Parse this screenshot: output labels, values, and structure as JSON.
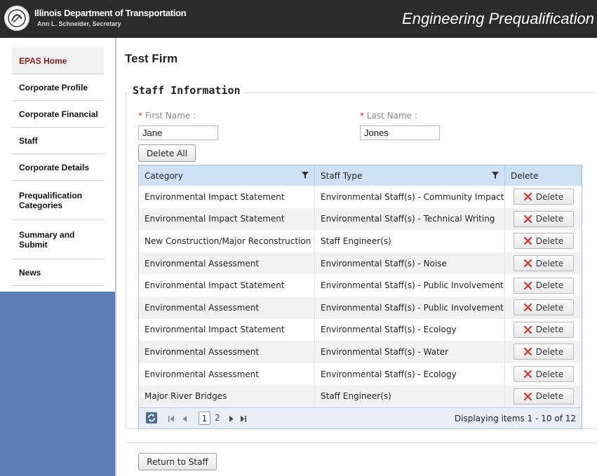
{
  "header": {
    "agency": "Illinois Department of Transportation",
    "secretary": "Ann L. Schneider, Secretary",
    "app_title": "Engineering Prequalification"
  },
  "sidebar": {
    "items": [
      {
        "label": "EPAS Home",
        "active": true
      },
      {
        "label": "Corporate Profile"
      },
      {
        "label": "Corporate Financial"
      },
      {
        "label": "Staff"
      },
      {
        "label": "Corporate Details"
      },
      {
        "label": "Prequalification Categories"
      },
      {
        "label": "Summary and Submit"
      },
      {
        "label": "News"
      }
    ]
  },
  "main": {
    "firm_title": "Test Firm",
    "section_title": "Staff Information",
    "first_name": {
      "required_mark": "*",
      "label": "First Name :",
      "value": "Jane"
    },
    "last_name": {
      "required_mark": "*",
      "label": "Last Name :",
      "value": "Jones"
    },
    "delete_all_label": "Delete All",
    "return_label": "Return to Staff"
  },
  "grid": {
    "columns": [
      "Category",
      "Staff Type",
      "Delete"
    ],
    "rows": [
      {
        "category": "Environmental Impact Statement",
        "staff_type": "Environmental Staff(s) - Community Impacts",
        "action": "Delete"
      },
      {
        "category": "Environmental Impact Statement",
        "staff_type": "Environmental Staff(s) - Technical Writing",
        "action": "Delete"
      },
      {
        "category": "New Construction/Major Reconstruction",
        "staff_type": "Staff Engineer(s)",
        "action": "Delete"
      },
      {
        "category": "Environmental Assessment",
        "staff_type": "Environmental Staff(s) - Noise",
        "action": "Delete"
      },
      {
        "category": "Environmental Impact Statement",
        "staff_type": "Environmental Staff(s) - Public Involvement",
        "action": "Delete"
      },
      {
        "category": "Environmental Assessment",
        "staff_type": "Environmental Staff(s) - Public Involvement",
        "action": "Delete"
      },
      {
        "category": "Environmental Impact Statement",
        "staff_type": "Environmental Staff(s) - Ecology",
        "action": "Delete"
      },
      {
        "category": "Environmental Assessment",
        "staff_type": "Environmental Staff(s) - Water",
        "action": "Delete"
      },
      {
        "category": "Environmental Assessment",
        "staff_type": "Environmental Staff(s) - Ecology",
        "action": "Delete"
      },
      {
        "category": "Major River Bridges",
        "staff_type": "Staff Engineer(s)",
        "action": "Delete"
      }
    ],
    "pager": {
      "pages": [
        "1",
        "2"
      ],
      "current_page": "1",
      "info": "Displaying items 1 - 10 of 12"
    }
  },
  "colors": {
    "header_bg": "#2b2b2b",
    "sidebar_blue": "#5a7fb7",
    "active_nav_text": "#8a1c1c",
    "grid_header_bg": "#cfe2f5",
    "delete_icon": "#d9302c",
    "required_mark": "#dd2222"
  }
}
